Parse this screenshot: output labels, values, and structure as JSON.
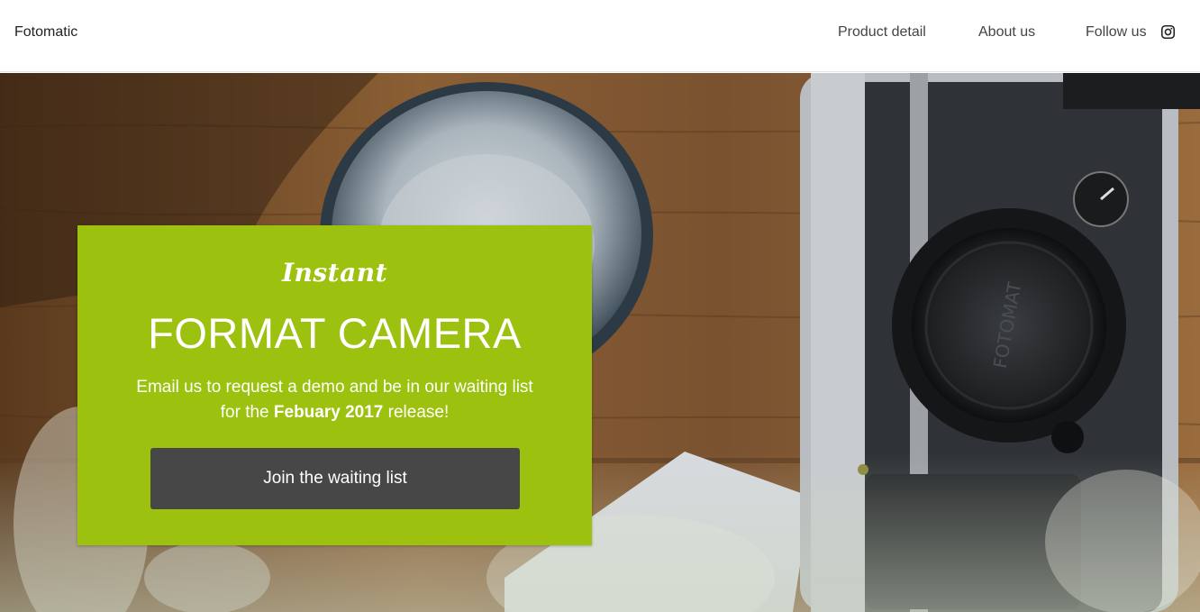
{
  "header": {
    "brand": "Fotomatic",
    "nav": [
      {
        "label": "Product detail"
      },
      {
        "label": "About us"
      },
      {
        "label": "Follow us"
      }
    ],
    "social_icon": "instagram-icon"
  },
  "hero": {
    "background": "camera-on-wooden-table-photo",
    "card": {
      "kicker": "Instant",
      "title": "FORMAT CAMERA",
      "text_before": "Email us to request a demo and be in our waiting list for the ",
      "text_bold": "Febuary 2017",
      "text_after": " release!",
      "cta_label": "Join the waiting list"
    }
  },
  "colors": {
    "accent": "#9cc10e",
    "button": "#474747",
    "text_dark": "#222222"
  }
}
